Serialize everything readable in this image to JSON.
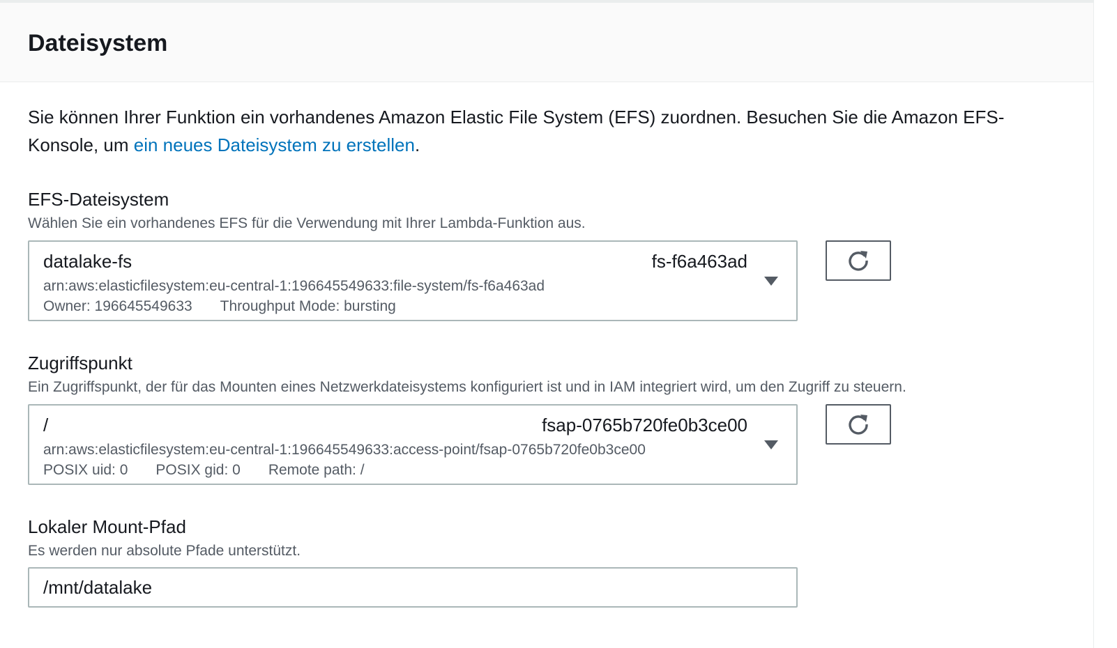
{
  "panel": {
    "title": "Dateisystem"
  },
  "intro": {
    "text_before": "Sie können Ihrer Funktion ein vorhandenes Amazon Elastic File System (EFS) zuordnen. Besuchen Sie die Amazon EFS-Konsole, um ",
    "link_text": "ein neues Dateisystem zu erstellen",
    "text_after": "."
  },
  "efs": {
    "label": "EFS-Dateisystem",
    "description": "Wählen Sie ein vorhandenes EFS für die Verwendung mit Ihrer Lambda-Funktion aus.",
    "selected_name": "datalake-fs",
    "selected_id": "fs-f6a463ad",
    "arn": "arn:aws:elasticfilesystem:eu-central-1:196645549633:file-system/fs-f6a463ad",
    "owner": "Owner: 196645549633",
    "throughput": "Throughput Mode: bursting"
  },
  "access_point": {
    "label": "Zugriffspunkt",
    "description": "Ein Zugriffspunkt, der für das Mounten eines Netzwerkdateisystems konfiguriert ist und in IAM integriert wird, um den Zugriff zu steuern.",
    "selected_path": "/",
    "selected_id": "fsap-0765b720fe0b3ce00",
    "arn": "arn:aws:elasticfilesystem:eu-central-1:196645549633:access-point/fsap-0765b720fe0b3ce00",
    "uid": "POSIX uid: 0",
    "gid": "POSIX gid: 0",
    "remote_path": "Remote path: /"
  },
  "mount_path": {
    "label": "Lokaler Mount-Pfad",
    "description": "Es werden nur absolute Pfade unterstützt.",
    "value": "/mnt/datalake"
  },
  "icons": {
    "refresh": "refresh-icon",
    "dropdown": "caret-down-icon"
  },
  "colors": {
    "link": "#0073bb",
    "text": "#16191f",
    "secondary_text": "#545b64",
    "border": "#aab7b8",
    "header_bg": "#fafafa"
  }
}
